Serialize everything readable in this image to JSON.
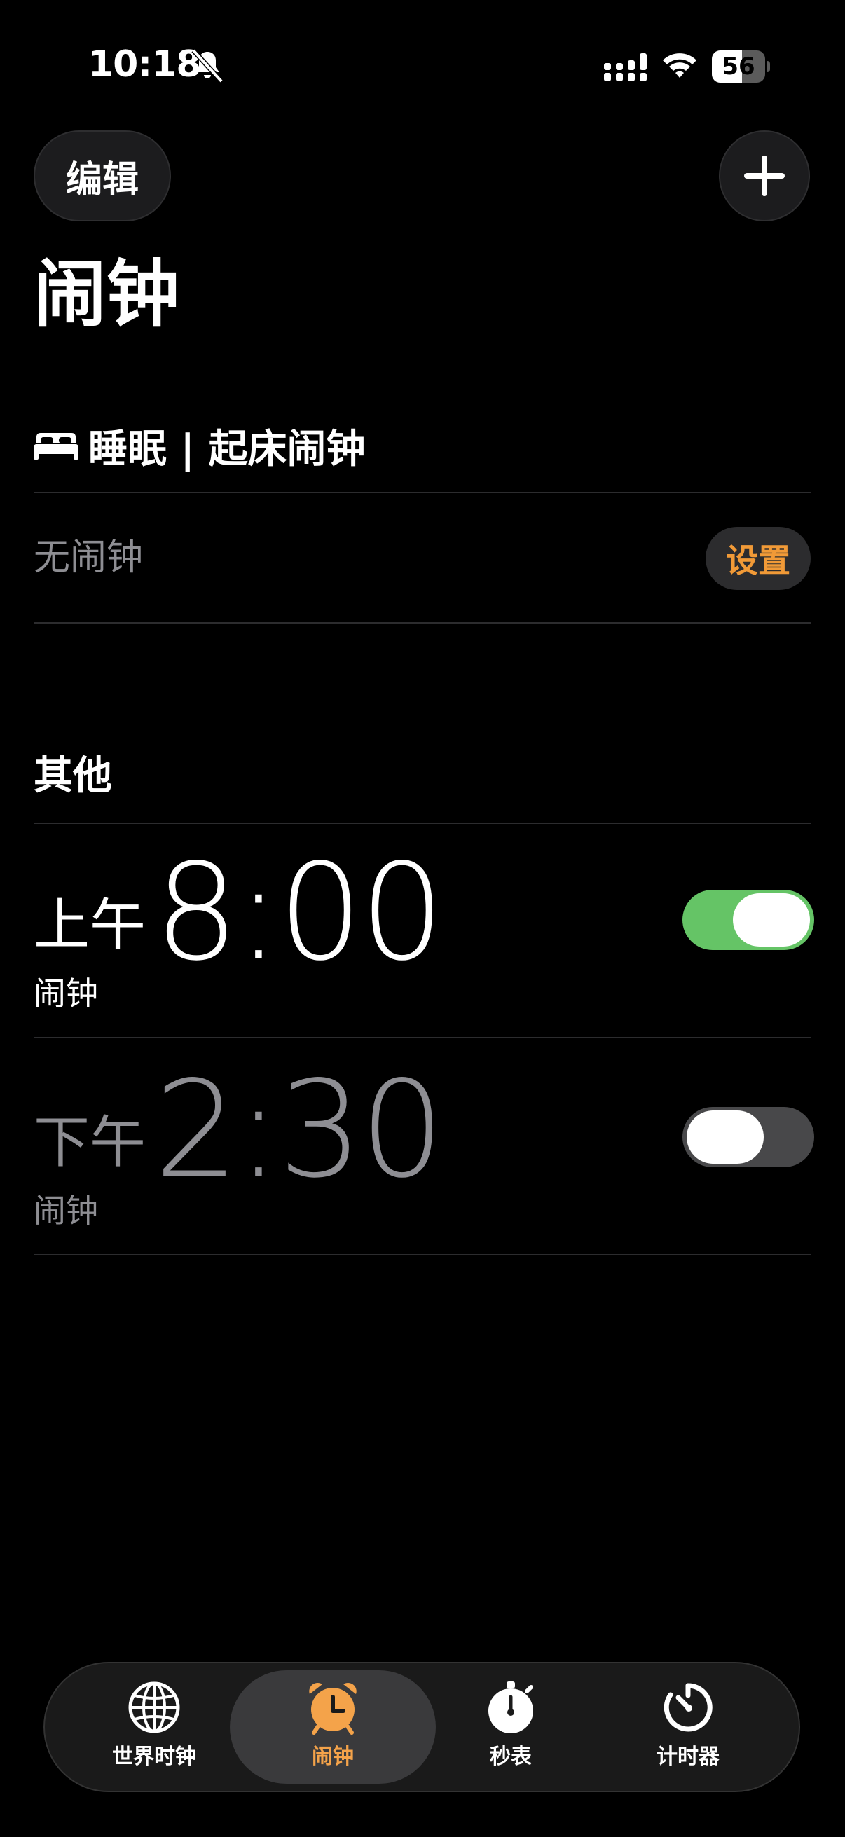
{
  "status_bar": {
    "time": "10:18",
    "battery": "56",
    "battery_level": 56
  },
  "header": {
    "edit_label": "编辑",
    "title": "闹钟"
  },
  "sleep": {
    "header": "睡眠 | 起床闹钟",
    "empty_label": "无闹钟",
    "setup_label": "设置"
  },
  "other": {
    "header": "其他",
    "alarms": [
      {
        "period": "上午",
        "time": "8:00",
        "label": "闹钟",
        "enabled": true
      },
      {
        "period": "下午",
        "time": "2:30",
        "label": "闹钟",
        "enabled": false
      }
    ]
  },
  "tabs": [
    {
      "label": "世界时钟",
      "icon": "globe-icon",
      "active": false
    },
    {
      "label": "闹钟",
      "icon": "alarm-clock-icon",
      "active": true
    },
    {
      "label": "秒表",
      "icon": "stopwatch-icon",
      "active": false
    },
    {
      "label": "计时器",
      "icon": "timer-icon",
      "active": false
    }
  ],
  "colors": {
    "accent": "#f19a37",
    "toggle_on": "#65c466",
    "toggle_off": "#48484a",
    "background": "#000000"
  }
}
